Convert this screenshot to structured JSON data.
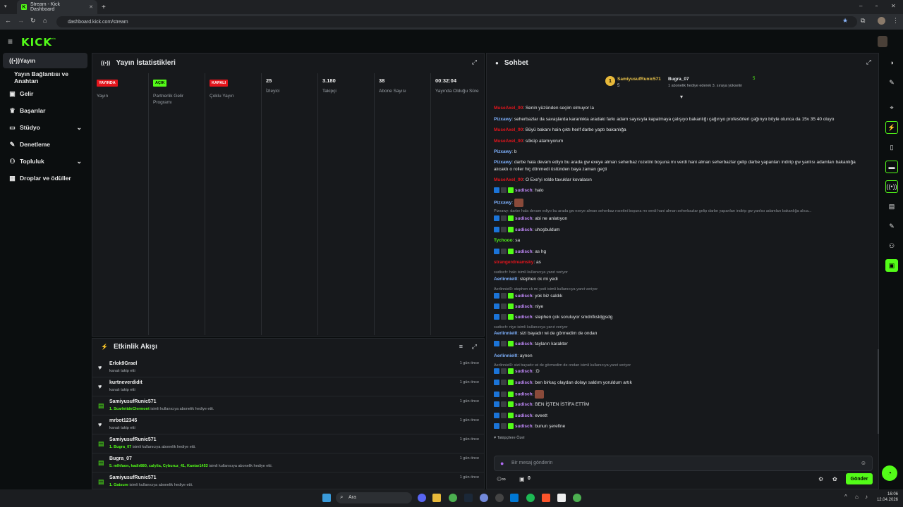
{
  "browser": {
    "tab_title": "Stream - Kick Dashboard",
    "url": "dashboard.kick.com/stream"
  },
  "brand": {
    "logo": "KICK",
    "logo_sup": "beta",
    "accent": "#53fc18"
  },
  "sidebar": {
    "items": [
      {
        "label": "Yayın",
        "icon": "broadcast-icon"
      },
      {
        "label": "Yayın Bağlantısı ve Anahtarı"
      },
      {
        "label": "Gelir",
        "icon": "dollar-icon"
      },
      {
        "label": "Başarılar",
        "icon": "trophy-icon"
      },
      {
        "label": "Stüdyo",
        "icon": "studio-icon"
      },
      {
        "label": "Denetleme",
        "icon": "wrench-icon"
      },
      {
        "label": "Topluluk",
        "icon": "community-icon"
      },
      {
        "label": "Droplar ve ödüller",
        "icon": "gift-icon"
      }
    ]
  },
  "stats": {
    "title": "Yayın İstatistikleri",
    "cells": [
      {
        "value": "YAYINDA",
        "label": "Yayın",
        "kind": "badge-red"
      },
      {
        "value": "AÇIK",
        "label": "Partnerlik Gelir Programı",
        "kind": "badge-green"
      },
      {
        "value": "KAPALI",
        "label": "Çoklu Yayın",
        "kind": "badge-red"
      },
      {
        "value": "25",
        "label": "İzleyici"
      },
      {
        "value": "3.180",
        "label": "Takipçi"
      },
      {
        "value": "38",
        "label": "Abone Sayısı"
      },
      {
        "value": "00:32:04",
        "label": "Yayında Olduğu Süre"
      }
    ]
  },
  "activity": {
    "title": "Etkinlik Akışı",
    "items": [
      {
        "user": "Erlok9Grael",
        "desc": "kanalı takip etti",
        "time": "1 gün önce",
        "icon": "heart-icon"
      },
      {
        "user": "kurtneverdidit",
        "desc": "kanalı takip etti",
        "time": "1 gün önce",
        "icon": "heart-icon"
      },
      {
        "user": "SamiyusufRunic571",
        "hl": "1. ScarlettdeClermont",
        "desc": "isimli kullanıcıya abonelik hediye etti.",
        "time": "1 gün önce",
        "icon": "gift-sub-icon"
      },
      {
        "user": "mrbot12345",
        "desc": "kanalı takip etti",
        "time": "1 gün önce",
        "icon": "heart-icon"
      },
      {
        "user": "SamiyusufRunic571",
        "hl": "1. Bugra_07",
        "desc": "isimli kullanıcıya abonelik hediye etti.",
        "time": "1 gün önce",
        "icon": "gift-sub-icon"
      },
      {
        "user": "Bugra_07",
        "hl": "5. mlhfaon, kadir880, calylia, Cyburuz_41, Kantar1453",
        "desc": "isimli kullanıcıya abonelik hediye etti.",
        "time": "1 gün önce",
        "icon": "gift-sub-icon"
      },
      {
        "user": "SamiyusufRunic571",
        "hl": "1. Gatsure",
        "desc": "isimli kullanıcıya abonelik hediye etti.",
        "time": "1 gün önce",
        "icon": "gift-sub-icon"
      }
    ]
  },
  "chat": {
    "title": "Sohbet",
    "leaderboard": {
      "first_user": "SamiyusufRunic571",
      "first_count": "5",
      "second_user": "Bugra_07",
      "second_count": "5",
      "second_note": "1 abonelik hediye ederek 3. sıraya yükselin"
    },
    "messages": [
      {
        "user": "MuseAxel_90",
        "color": "#e4151c",
        "text": "Senin yüzünden seçim olmuyor la"
      },
      {
        "user": "Pizxawy",
        "color": "#7fb2ff",
        "text": "seherbazlar da savaşlarda karanlıkla aradaki farkı adam sayısıyla kapatmaya çalışıyo bakanlığı çağırıyo profesörleri çağırıyo böyle olunca da 15v 35 40 oluyo"
      },
      {
        "user": "MuseAxel_90",
        "color": "#e4151c",
        "text": "Büyü bakanı hain çıktı herif darbe yaptı bakanlığa"
      },
      {
        "user": "MuseAxel_90",
        "color": "#e4151c",
        "text": "söküp atamıyorum"
      },
      {
        "user": "Pizxawy",
        "color": "#7fb2ff",
        "text": "b"
      },
      {
        "user": "Pizxawy",
        "color": "#7fb2ff",
        "text": "darbe hala devam ediyo bu arada gw exeye alman seherbaz rozetini boşuna mı verdi hani alman seherbazlar gelip darbe yapanları indirip gw yanlısı adamları bakanlığa alıcaktı o roller hiç dönmedi üstünden baya zaman geçti"
      },
      {
        "user": "MuseAxel_90",
        "color": "#e4151c",
        "text": "O Exe'yi rolde tavuklar kovalasın"
      },
      {
        "user": "sudisch",
        "color": "#c58cff",
        "text": "halo",
        "badges": true
      },
      {
        "user": "Pizxawy",
        "color": "#7fb2ff",
        "text": "",
        "emote": true
      },
      {
        "reply": "Pizxawy: darbe hala devam ediyo bu arada gw exeye alman seherbaz rozetini boşuna mı verdi hani alman seherbazlar gelip darbe yapanları indirip gw yanlısı adamları bakanlığa alıca..."
      },
      {
        "user": "sudisch",
        "color": "#c58cff",
        "text": "abi ne anlatıyon",
        "badges": true
      },
      {
        "user": "sudisch",
        "color": "#c58cff",
        "text": "uhoşbuldum",
        "badges": true
      },
      {
        "user": "Tychooo",
        "color": "#53fc18",
        "text": "sa"
      },
      {
        "user": "sudisch",
        "color": "#c58cff",
        "text": "as hg",
        "badges": true
      },
      {
        "user": "strangerdreamsky",
        "color": "#e4151c",
        "text": "as"
      },
      {
        "reply": "sudisch: halo isimli kullanıcıya yanıt veriyor"
      },
      {
        "user": "Aerlinniel0",
        "color": "#7fb2ff",
        "text": "stephen ck mi yedi"
      },
      {
        "reply": "Aerlinniel0: stephen ck mi yedi isimli kullanıcıya yanıt veriyor"
      },
      {
        "user": "sudisch",
        "color": "#c58cff",
        "text": "yok biz saldık",
        "badges": true
      },
      {
        "user": "sudisch",
        "color": "#c58cff",
        "text": "niye",
        "badges": true
      },
      {
        "user": "sudisch",
        "color": "#c58cff",
        "text": "stephen çok soruluyor smdnfksldjgsdg",
        "badges": true
      },
      {
        "reply": "sudisch: niye isimli kullanıcıya yanıt veriyor"
      },
      {
        "user": "Aerlinniel0",
        "color": "#7fb2ff",
        "text": "sizi bayadır wi de görmedim de ondan"
      },
      {
        "user": "sudisch",
        "color": "#c58cff",
        "text": "tayların karakter",
        "badges": true
      },
      {
        "user": "Aerlinniel0",
        "color": "#7fb2ff",
        "text": "aynen"
      },
      {
        "reply": "Aerlinniel0: sizi bayadır wi de görmedim de ondan isimli kullanıcıya yanıt veriyor"
      },
      {
        "user": "sudisch",
        "color": "#c58cff",
        "text": ":D",
        "badges": true
      },
      {
        "user": "sudisch",
        "color": "#c58cff",
        "text": "ben birkaç olaydan dolayı saldım yoruldum artık",
        "badges": true
      },
      {
        "user": "sudisch",
        "color": "#c58cff",
        "text": "",
        "badges": true,
        "emote": true
      },
      {
        "user": "sudisch",
        "color": "#c58cff",
        "text": "BEN İŞTEN İSTİFA ETTİM",
        "badges": true
      },
      {
        "user": "sudisch",
        "color": "#c58cff",
        "text": "eveett",
        "badges": true
      },
      {
        "user": "sudisch",
        "color": "#c58cff",
        "text": "bunun şerefine",
        "badges": true
      }
    ],
    "followers_only": "Takipçilere Özel",
    "input_placeholder": "Bir mesaj gönderin",
    "points": "0",
    "send_label": "Gönder"
  },
  "taskbar": {
    "search": "Ara",
    "time": "16:06",
    "date": "12.04.2026"
  }
}
